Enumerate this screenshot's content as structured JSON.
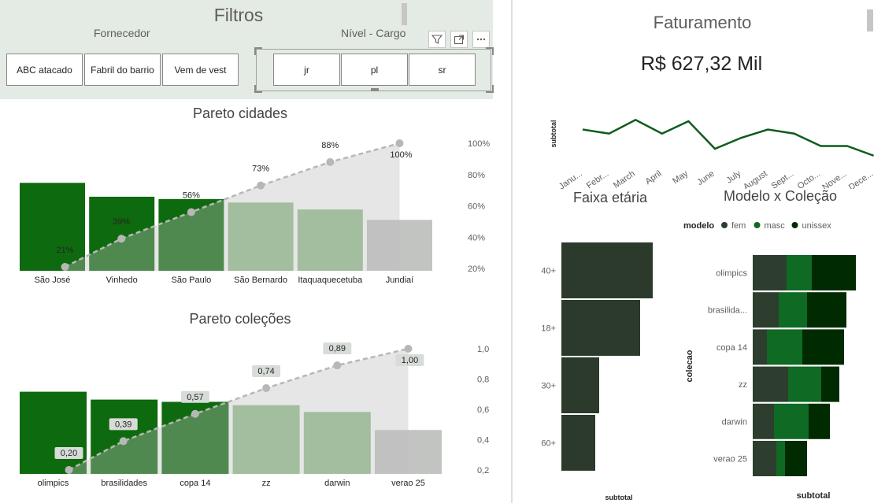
{
  "filters": {
    "title": "Filtros",
    "fornecedor": {
      "label": "Fornecedor",
      "options": [
        "ABC atacado",
        "Fabril do barrio",
        "Vem de vest"
      ]
    },
    "nivel_cargo": {
      "label": "Nível - Cargo",
      "options": [
        "jr",
        "pl",
        "sr"
      ]
    }
  },
  "faturamento": {
    "title": "Faturamento",
    "value": "R$ 627,32 Mil",
    "ylabel": "subtotal"
  },
  "colors": {
    "bar_dark": "#0e6a0e",
    "bar_mid": "#4f8a4a",
    "bar_light": "#93bf8d",
    "bar_grey": "#c2c4c2",
    "cumulative_line": "#b6b8b6",
    "faixa_bar": "#2b3a2b",
    "fem": "#2d3e2e",
    "masc": "#0f6a23",
    "unissex": "#002b00"
  },
  "chart_data": [
    {
      "type": "bar",
      "title": "Pareto cidades",
      "categories": [
        "São José",
        "Vinhedo",
        "São Paulo",
        "São Bernardo",
        "Itaquaquecetuba",
        "Jundiaí"
      ],
      "series": [
        {
          "values": [
            76,
            64,
            62,
            59,
            53,
            44
          ]
        },
        {
          "values": [
            21,
            39,
            56,
            73,
            88,
            100
          ],
          "labels": [
            "21%",
            "39%",
            "56%",
            "73%",
            "88%",
            "100%"
          ]
        }
      ],
      "y2ticks": [
        "100%",
        "80%",
        "60%",
        "40%",
        "20%"
      ],
      "y2lim": [
        20,
        100
      ]
    },
    {
      "type": "bar",
      "title": "Pareto coleções",
      "categories": [
        "olimpics",
        "brasilidades",
        "copa 14",
        "zz",
        "darwin",
        "verao 25"
      ],
      "series": [
        {
          "values": [
            73,
            66,
            64,
            61,
            55,
            39
          ]
        },
        {
          "values": [
            0.2,
            0.39,
            0.57,
            0.74,
            0.89,
            1.0
          ],
          "labels": [
            "0,20",
            "0,39",
            "0,57",
            "0,74",
            "0,89",
            "1,00"
          ]
        }
      ],
      "y2ticks": [
        "1,0",
        "0,8",
        "0,6",
        "0,4",
        "0,2"
      ],
      "y2lim": [
        0.2,
        1.0
      ]
    },
    {
      "type": "line",
      "categories": [
        "Janu...",
        "Febr...",
        "March",
        "April",
        "May",
        "June",
        "July",
        "August",
        "Sept...",
        "Octo...",
        "Nove...",
        "Dece..."
      ],
      "values": [
        57,
        55.5,
        60.5,
        55.5,
        60,
        50,
        54,
        57,
        55.5,
        51,
        51,
        47.5
      ],
      "ylabel": "subtotal"
    },
    {
      "type": "bar",
      "title": "Faixa etária",
      "categories": [
        "40+",
        "18+",
        "30+",
        "60+"
      ],
      "values": [
        116,
        100,
        48,
        43
      ],
      "xlabel": "subtotal"
    },
    {
      "type": "bar",
      "title": "Modelo x Coleção",
      "legend_title": "modelo",
      "categories": [
        "olimpics",
        "brasilida...",
        "copa 14",
        "zz",
        "darwin",
        "verao 25"
      ],
      "series": [
        {
          "name": "fem",
          "values": [
            43,
            33,
            18,
            45,
            27,
            30
          ]
        },
        {
          "name": "masc",
          "values": [
            32,
            36,
            45,
            42,
            44,
            11
          ]
        },
        {
          "name": "unissex",
          "values": [
            56,
            50,
            53,
            23,
            27,
            28
          ]
        }
      ],
      "xlabel": "subtotal",
      "ylabel": "colecao"
    }
  ]
}
